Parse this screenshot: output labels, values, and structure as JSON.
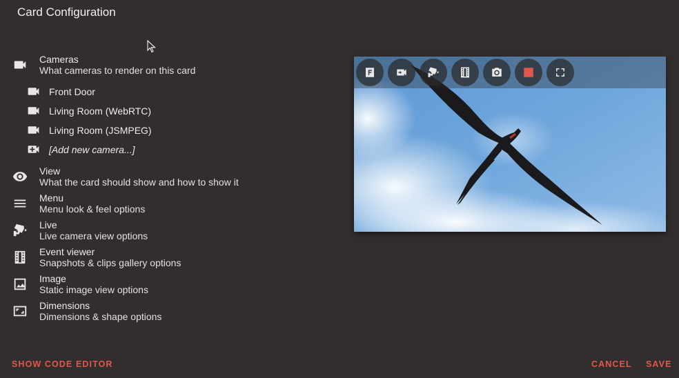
{
  "dialog": {
    "title": "Card Configuration"
  },
  "sections": {
    "cameras": {
      "label": "Cameras",
      "description": "What cameras to render on this card",
      "icon": "video-icon"
    },
    "view": {
      "label": "View",
      "description": "What the card should show and how to show it",
      "icon": "eye-icon"
    },
    "menu": {
      "label": "Menu",
      "description": "Menu look & feel options",
      "icon": "menu-icon"
    },
    "live": {
      "label": "Live",
      "description": "Live camera view options",
      "icon": "cctv-icon"
    },
    "event_viewer": {
      "label": "Event viewer",
      "description": "Snapshots & clips gallery options",
      "icon": "filmstrip-icon"
    },
    "image": {
      "label": "Image",
      "description": "Static image view options",
      "icon": "image-icon"
    },
    "dimensions": {
      "label": "Dimensions",
      "description": "Dimensions & shape options",
      "icon": "aspect-ratio-icon"
    }
  },
  "cameras": [
    {
      "label": "Front Door",
      "icon": "video-icon"
    },
    {
      "label": "Living Room (WebRTC)",
      "icon": "video-icon"
    },
    {
      "label": "Living Room (JSMPEG)",
      "icon": "video-icon"
    },
    {
      "label": "[Add new camera...]",
      "icon": "video-plus-icon"
    }
  ],
  "preview_toolbar": [
    {
      "icon": "frigate-logo-icon"
    },
    {
      "icon": "camera-switch-icon"
    },
    {
      "icon": "cctv-icon"
    },
    {
      "icon": "filmstrip-icon"
    },
    {
      "icon": "camera-icon"
    },
    {
      "icon": "image-icon",
      "active": true
    },
    {
      "icon": "fullscreen-icon"
    }
  ],
  "footer": {
    "code_editor": "SHOW CODE EDITOR",
    "cancel": "CANCEL",
    "save": "SAVE"
  },
  "colors": {
    "background": "#332e2e",
    "accent": "#e2574c",
    "text": "#e8e6e6"
  }
}
